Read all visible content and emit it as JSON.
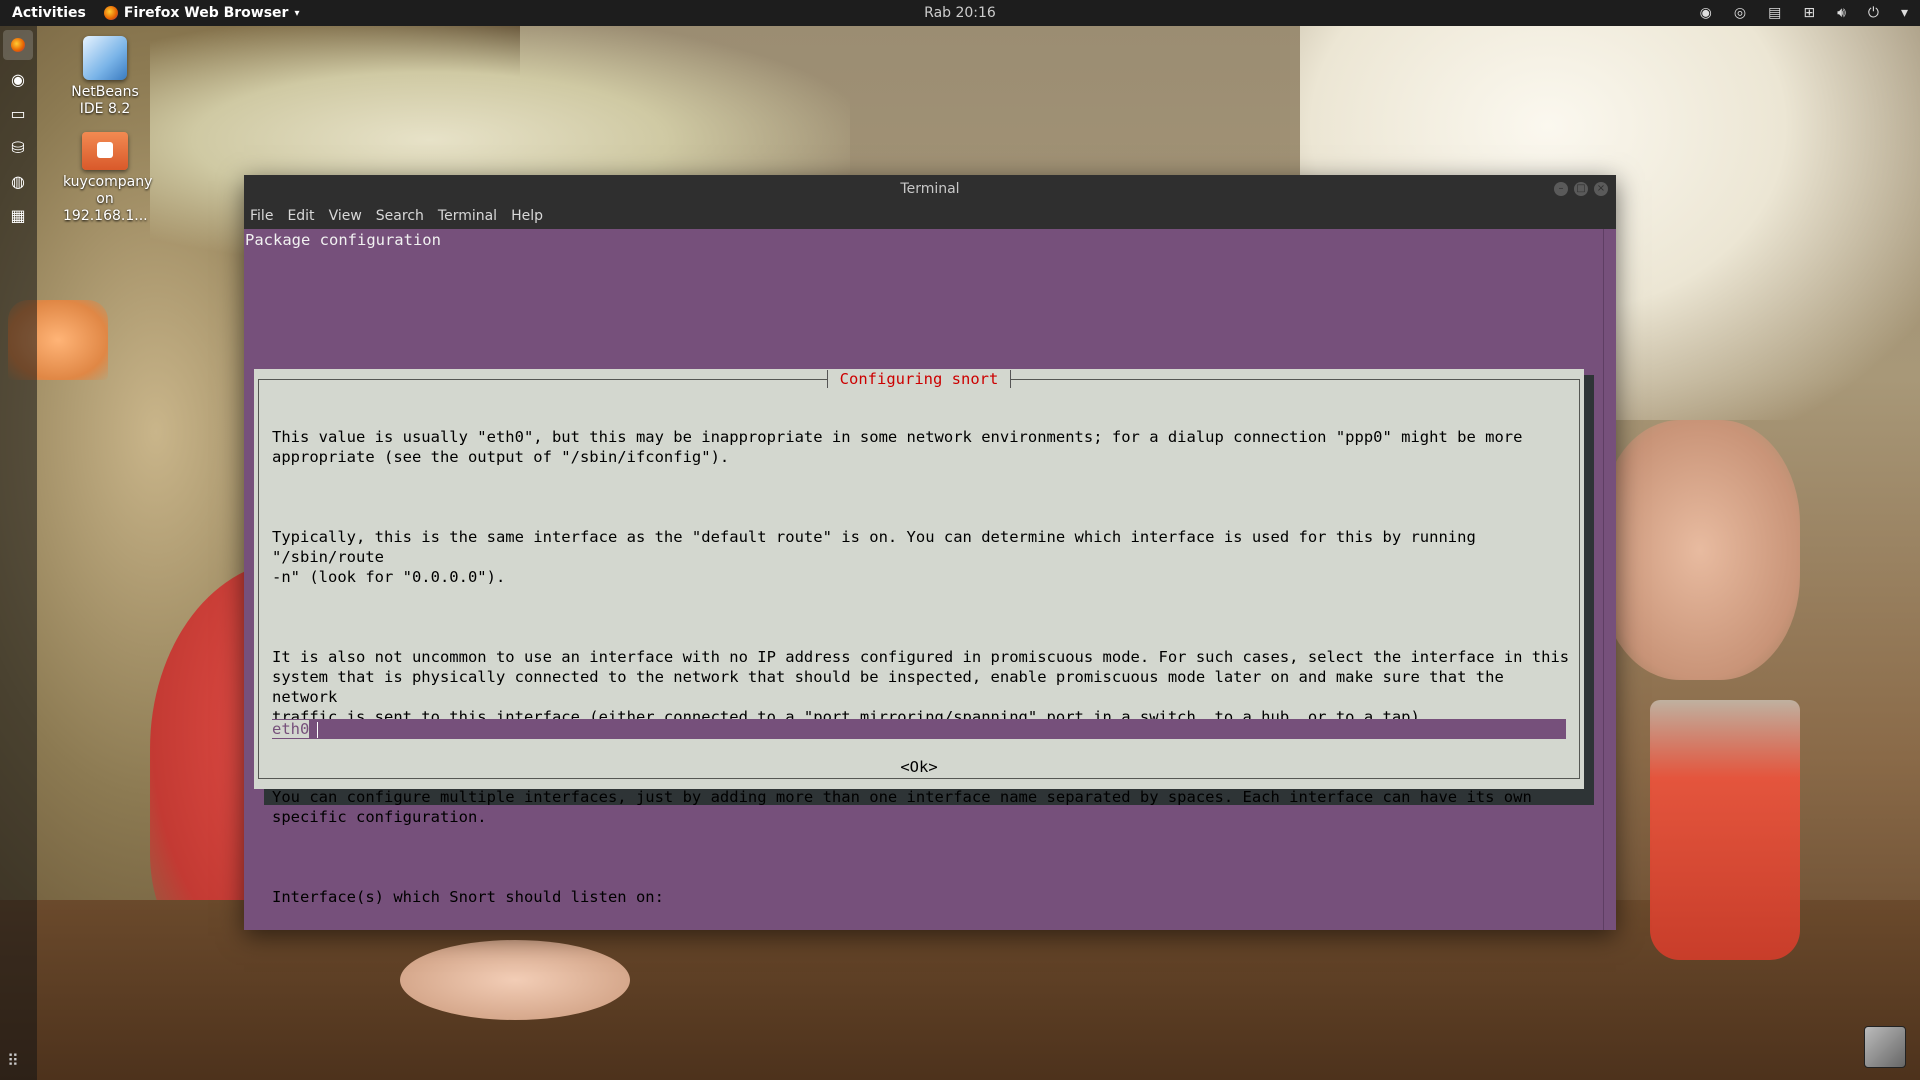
{
  "topbar": {
    "activities": "Activities",
    "app_name": "Firefox Web Browser",
    "clock": "Rab 20:16"
  },
  "desktop": {
    "icons": [
      {
        "label": "NetBeans IDE 8.2"
      },
      {
        "label": "kuycompany on 192.168.1..."
      }
    ]
  },
  "terminal": {
    "title": "Terminal",
    "menu": [
      "File",
      "Edit",
      "View",
      "Search",
      "Terminal",
      "Help"
    ],
    "header": "Package configuration",
    "dialog": {
      "title": "Configuring snort",
      "paragraphs": [
        "This value is usually \"eth0\", but this may be inappropriate in some network environments; for a dialup connection \"ppp0\" might be more\nappropriate (see the output of \"/sbin/ifconfig\").",
        "Typically, this is the same interface as the \"default route\" is on. You can determine which interface is used for this by running \"/sbin/route\n-n\" (look for \"0.0.0.0\").",
        "It is also not uncommon to use an interface with no IP address configured in promiscuous mode. For such cases, select the interface in this\nsystem that is physically connected to the network that should be inspected, enable promiscuous mode later on and make sure that the network\ntraffic is sent to this interface (either connected to a \"port mirroring/spanning\" port in a switch, to a hub, or to a tap).",
        "You can configure multiple interfaces, just by adding more than one interface name separated by spaces. Each interface can have its own\nspecific configuration.",
        "Interface(s) which Snort should listen on:"
      ],
      "input_value": "eth0",
      "ok_label": "<Ok>"
    }
  },
  "colors": {
    "terminal_bg": "#76507b",
    "dialog_bg": "#d3d7cf",
    "dialog_title": "#cc0000"
  }
}
